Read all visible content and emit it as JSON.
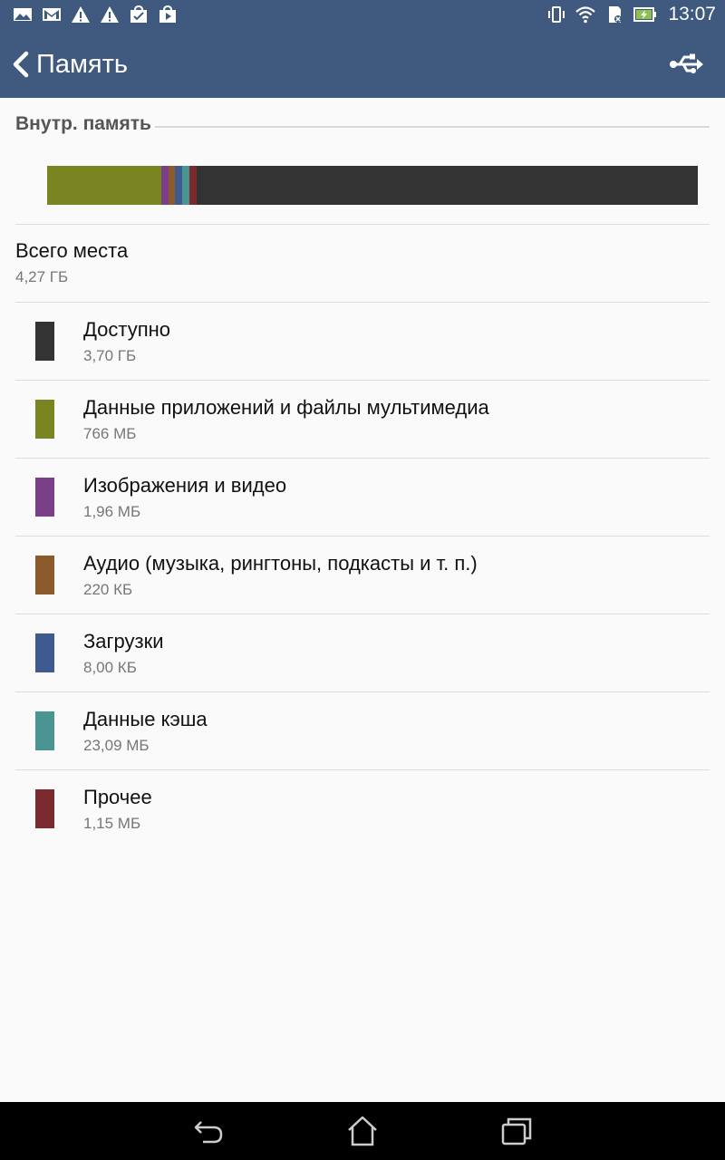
{
  "status_bar": {
    "time": "13:07",
    "left_icons": [
      "gallery-icon",
      "gmail-icon",
      "warning-icon",
      "warning-icon",
      "store-bag-icon",
      "play-store-icon"
    ],
    "right_icons": [
      "vibrate-icon",
      "wifi-icon",
      "sd-card-icon",
      "battery-charging-icon"
    ]
  },
  "app_bar": {
    "title": "Память",
    "back_icon": "chevron-left-icon",
    "action_icon": "usb-icon"
  },
  "section": {
    "title": "Внутр. память"
  },
  "usage_bar": {
    "segments": [
      {
        "name": "Данные приложений и файлы мультимедиа",
        "fraction": 0.175,
        "color": "#7a8421"
      },
      {
        "name": "Изображения и видео",
        "fraction": 0.011,
        "color": "#7b3f8a"
      },
      {
        "name": "Аудио",
        "fraction": 0.011,
        "color": "#8c5a2b"
      },
      {
        "name": "Загрузки",
        "fraction": 0.011,
        "color": "#3f5a8e"
      },
      {
        "name": "Данные кэша",
        "fraction": 0.011,
        "color": "#4a9591"
      },
      {
        "name": "Прочее",
        "fraction": 0.011,
        "color": "#7b2a2e"
      }
    ],
    "remaining_color": "#333333"
  },
  "total": {
    "title": "Всего места",
    "value": "4,27 ГБ"
  },
  "items": [
    {
      "title": "Доступно",
      "value": "3,70 ГБ",
      "color": "#333333"
    },
    {
      "title": "Данные приложений и файлы мультимедиа",
      "value": "766 МБ",
      "color": "#7a8421"
    },
    {
      "title": "Изображения и видео",
      "value": "1,96 МБ",
      "color": "#7b3f8a"
    },
    {
      "title": "Аудио (музыка, рингтоны, подкасты и т. п.)",
      "value": "220 КБ",
      "color": "#8c5a2b"
    },
    {
      "title": "Загрузки",
      "value": "8,00 КБ",
      "color": "#3f5a8e"
    },
    {
      "title": "Данные кэша",
      "value": "23,09 МБ",
      "color": "#4a9591"
    },
    {
      "title": "Прочее",
      "value": "1,15 МБ",
      "color": "#7b2a2e"
    }
  ],
  "nav_bar": {
    "icons": [
      "back-icon",
      "home-icon",
      "recent-apps-icon"
    ]
  }
}
